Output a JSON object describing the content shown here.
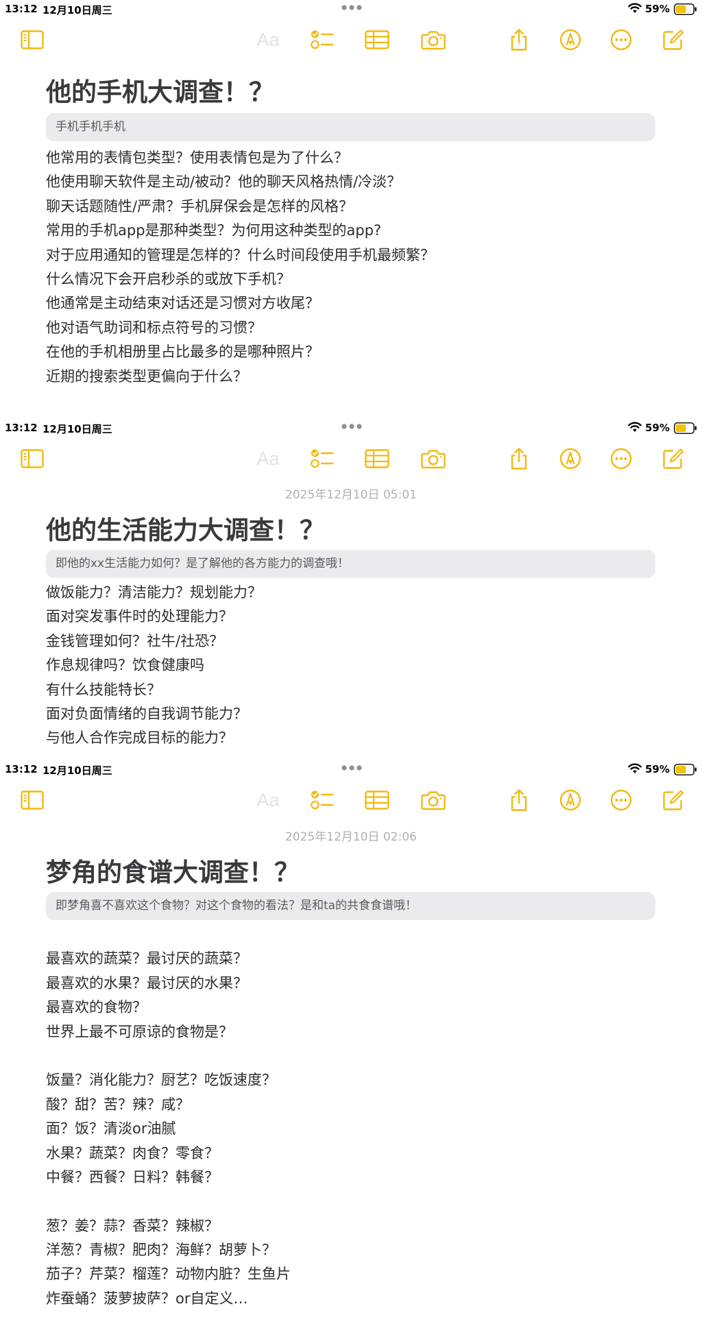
{
  "status_bar": {
    "time": "13:12",
    "date": "12月10日周三",
    "battery": "59%"
  },
  "toolbar": {
    "format_label": "Aa",
    "icons": [
      "sidebar-icon",
      "checklist-icon",
      "table-icon",
      "camera-icon",
      "share-icon",
      "markup-icon",
      "more-icon",
      "compose-icon"
    ]
  },
  "colors": {
    "accent": "#f2b90f",
    "disabled": "#e2e2e6",
    "title": "#3a3a3c",
    "quote_bg": "#ebebed"
  },
  "notes": [
    {
      "date": "",
      "title": "他的手机大调查！？",
      "quote": "手机手机手机",
      "lines": [
        "他常用的表情包类型？使用表情包是为了什么？",
        "他使用聊天软件是主动/被动？他的聊天风格热情/冷淡？",
        "聊天话题随性/严肃？手机屏保会是怎样的风格？",
        "常用的手机app是那种类型？为何用这种类型的app?",
        "对于应用通知的管理是怎样的？什么时间段使用手机最频繁？",
        "什么情况下会开启秒杀的或放下手机？",
        "他通常是主动结束对话还是习惯对方收尾？",
        "他对语气助词和标点符号的习惯？",
        "在他的手机相册里占比最多的是哪种照片？",
        "近期的搜索类型更偏向于什么？"
      ]
    },
    {
      "date": "2025年12月10日 05:01",
      "title": "他的生活能力大调查！？",
      "quote": "即他的xx生活能力如何？是了解他的各方能力的调查哦！",
      "lines": [
        "做饭能力？清洁能力？规划能力？",
        "面对突发事件时的处理能力？",
        "金钱管理如何？社牛/社恐？",
        "作息规律吗？饮食健康吗",
        "有什么技能特长？",
        "面对负面情绪的自我调节能力？",
        "与他人合作完成目标的能力？"
      ]
    },
    {
      "date": "2025年12月10日 02:06",
      "title": "梦角的食谱大调查！？",
      "quote": "即梦角喜不喜欢这个食物？对这个食物的看法？是和ta的共食食谱哦！",
      "lines": [
        "",
        "最喜欢的蔬菜？最讨厌的蔬菜？",
        "最喜欢的水果？最讨厌的水果？",
        "最喜欢的食物？",
        "世界上最不可原谅的食物是？",
        "",
        "饭量？消化能力？厨艺？吃饭速度？",
        "酸？甜？苦？辣？咸？",
        "面？饭？清淡or油腻",
        "水果？蔬菜？肉食？零食？",
        "中餐？西餐？日料？韩餐？",
        "",
        "葱？姜？蒜？香菜？辣椒？",
        "洋葱？青椒？肥肉？海鲜？胡萝卜？",
        "茄子？芹菜？榴莲？动物内脏？生鱼片",
        "炸蚕蛹？菠萝披萨？or自定义…"
      ]
    }
  ]
}
